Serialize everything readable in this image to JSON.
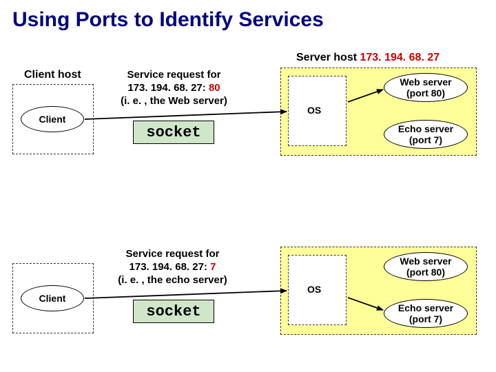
{
  "title": "Using Ports to Identify Services",
  "server_header": {
    "label": "Server host ",
    "ip": "173. 194. 68. 27"
  },
  "client_host_label": "Client host",
  "client_label": "Client",
  "os_label": "OS",
  "request1": {
    "prefix": "Service request for",
    "addr": "173. 194. 68. 27:",
    "port": " 80",
    "suffix": "(i. e. , the Web server)"
  },
  "request2": {
    "prefix": "Service request for",
    "addr": "173. 194. 68. 27:",
    "port": " 7",
    "suffix": "(i. e. , the echo server)"
  },
  "socket_label": "socket",
  "services": {
    "web": {
      "name": "Web server",
      "port_line": "(port 80)"
    },
    "echo": {
      "name": "Echo server",
      "port_line": "(port 7)"
    }
  }
}
